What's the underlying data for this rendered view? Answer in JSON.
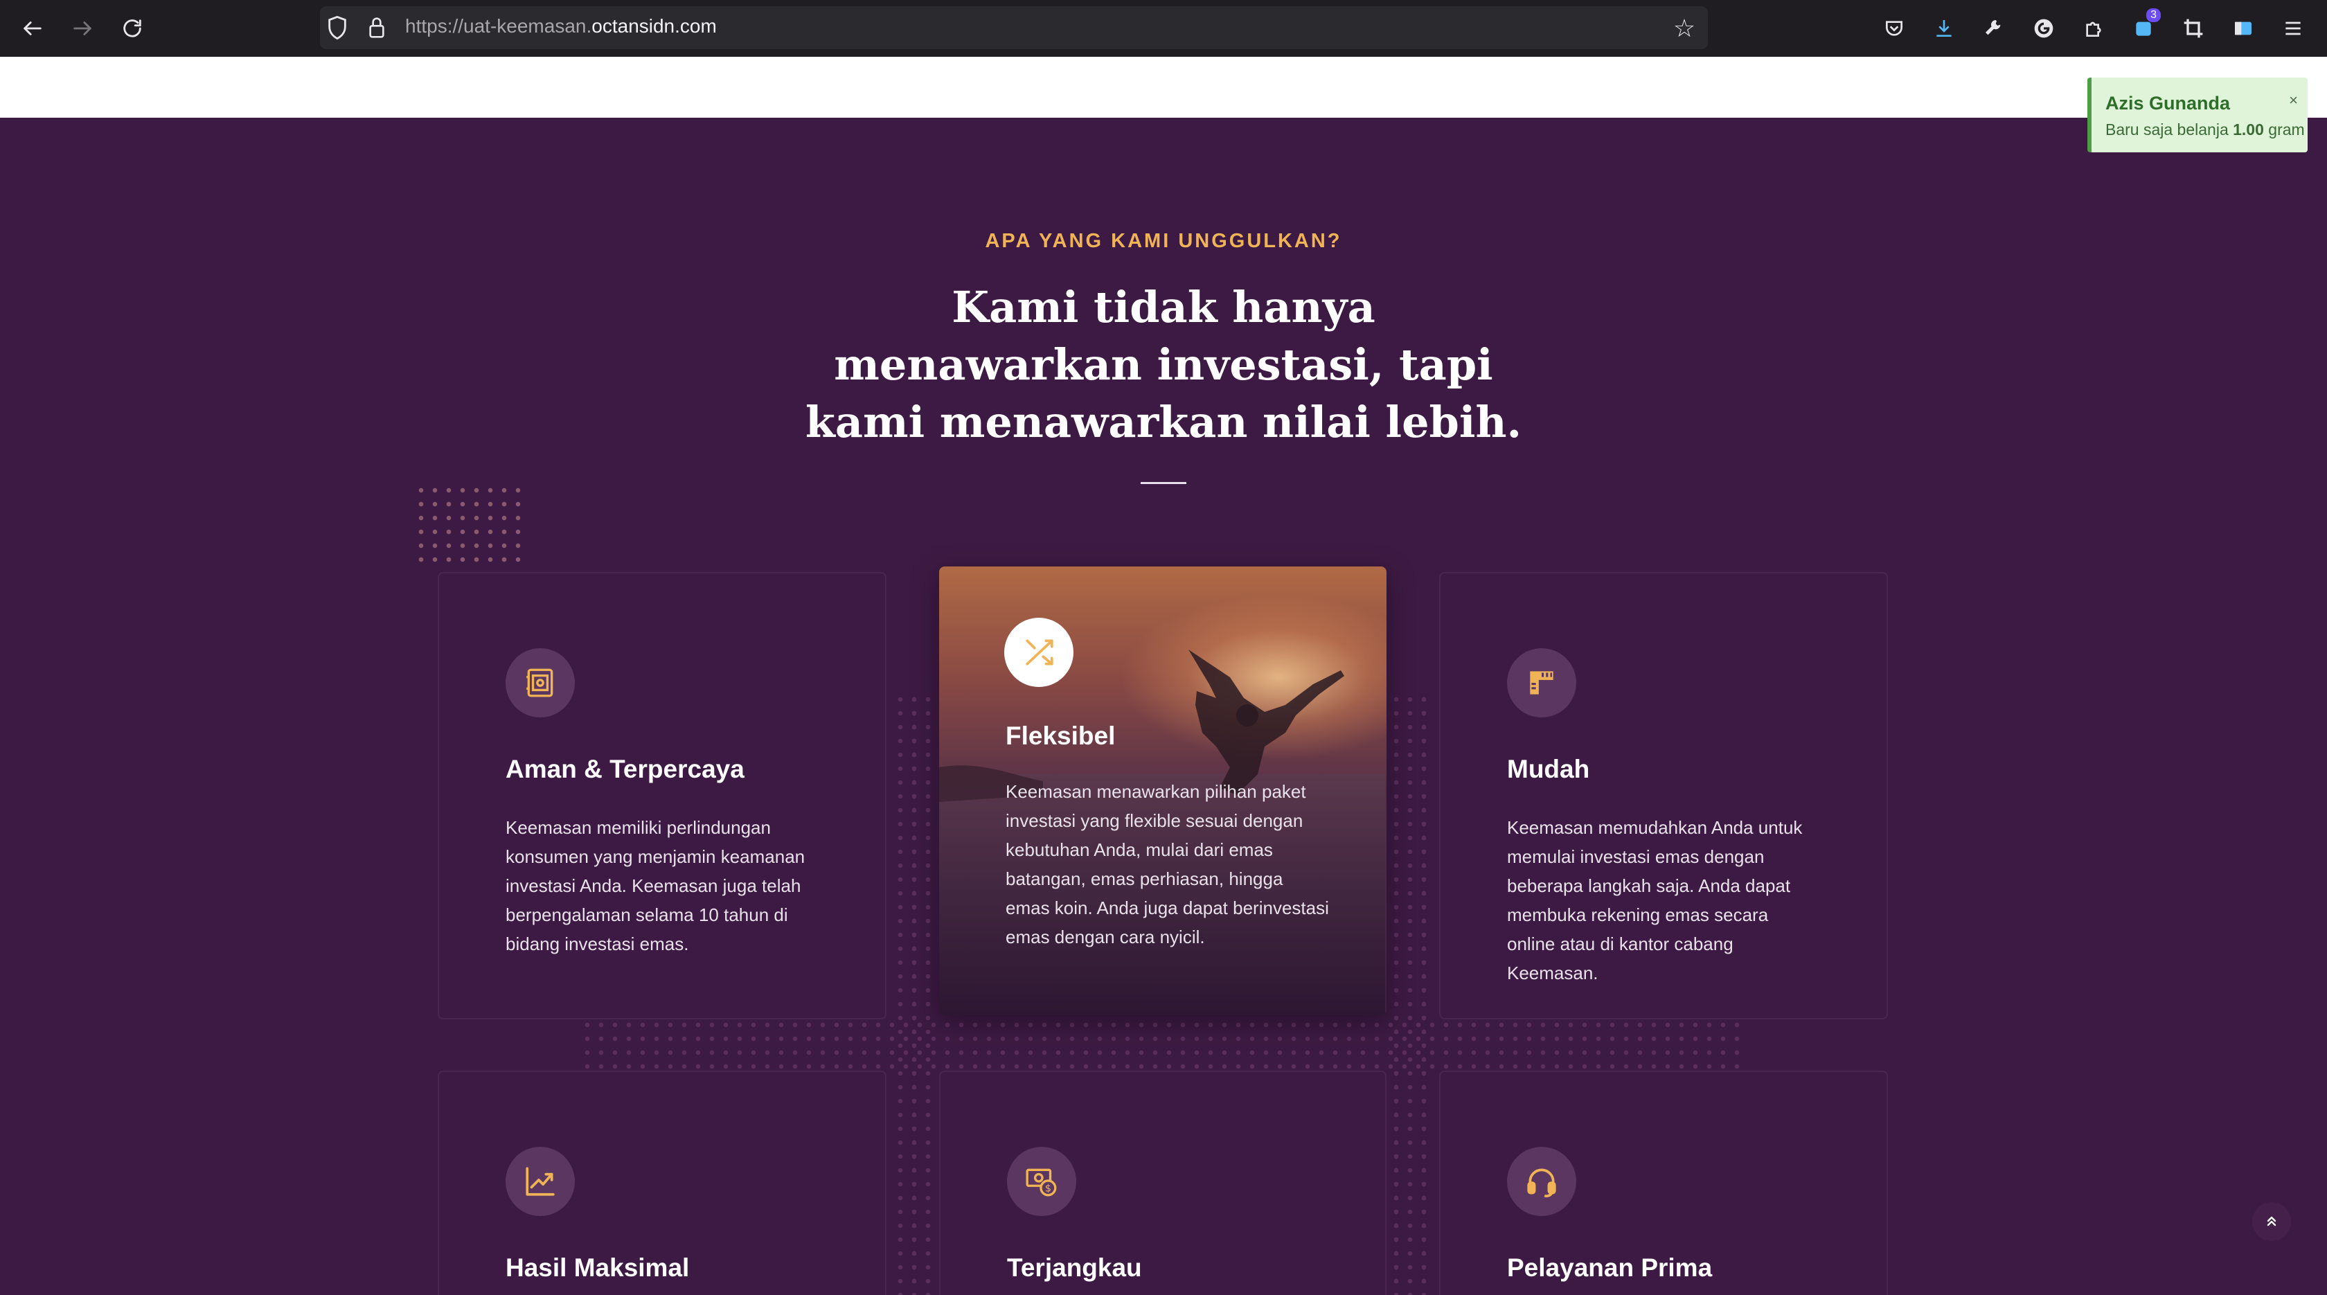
{
  "browser": {
    "url_prefix": "https://uat-keemasan.",
    "url_domain": "octansidn.com",
    "downloads_badge": "3"
  },
  "section": {
    "eyebrow": "APA YANG KAMI UNGGULKAN?",
    "headline": "Kami tidak hanya menawarkan investasi, tapi kami menawarkan nilai lebih."
  },
  "cards": [
    {
      "title": "Aman & Terpercaya",
      "description": "Keemasan memiliki perlindungan konsumen yang menjamin keamanan investasi Anda. Keemasan juga telah berpengalaman selama 10 tahun di bidang investasi emas.",
      "icon": "safe-icon"
    },
    {
      "title": "Fleksibel",
      "description": "Keemasan menawarkan pilihan paket investasi yang flexible sesuai dengan kebutuhan Anda, mulai dari emas batangan, emas perhiasan, hingga emas koin. Anda juga dapat berinvestasi emas dengan cara nyicil.",
      "icon": "shuffle-icon"
    },
    {
      "title": "Mudah",
      "description": "Keemasan memudahkan Anda untuk memulai investasi emas dengan beberapa langkah saja. Anda dapat membuka rekening emas secara online atau di kantor cabang Keemasan.",
      "icon": "ruler-icon"
    },
    {
      "title": "Hasil Maksimal",
      "icon": "chart-up-icon"
    },
    {
      "title": "Terjangkau",
      "icon": "money-icon"
    },
    {
      "title": "Pelayanan Prima",
      "icon": "headset-icon"
    }
  ],
  "toast": {
    "name": "Azis Gunanda",
    "message_prefix": "Baru saja belanja",
    "amount": "1.00",
    "unit": "gram",
    "close": "×"
  },
  "colors": {
    "section_bg": "#3d1a43",
    "accent_gold": "#f0b457",
    "toast_bg": "#dff4d9",
    "toast_text": "#2e6d2a"
  }
}
